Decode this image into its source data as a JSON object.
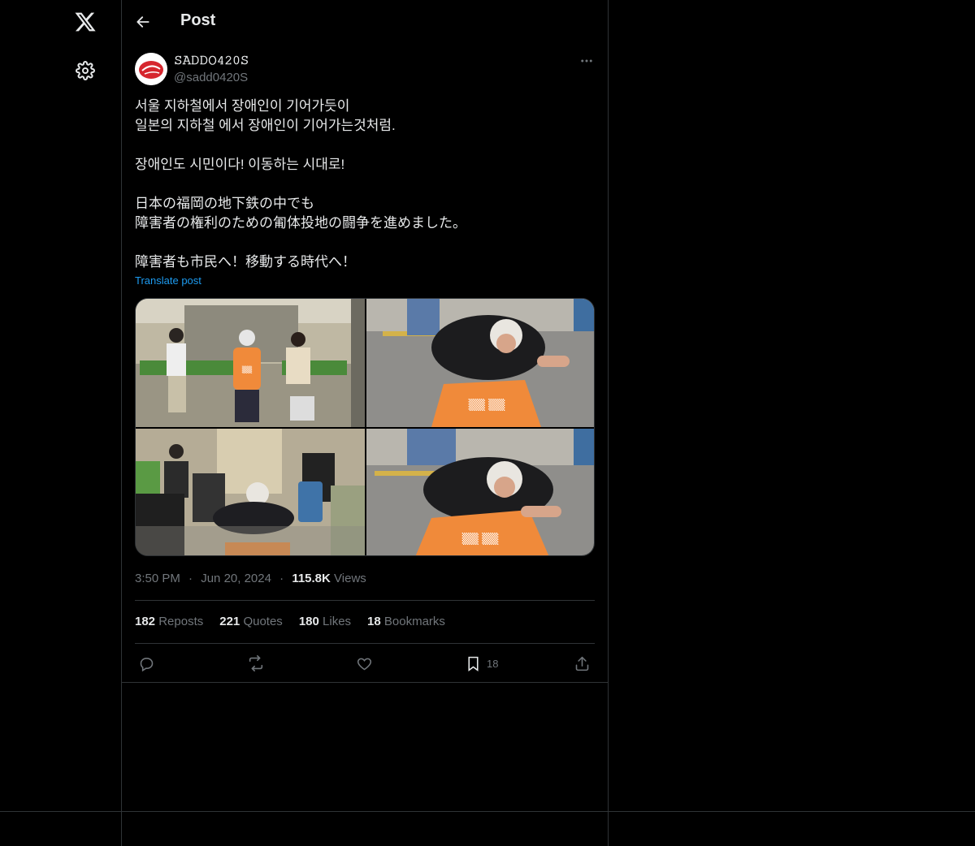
{
  "nav": {
    "logo": "X"
  },
  "header": {
    "title": "Post"
  },
  "post": {
    "author_name": "𝚂𝙰𝙳𝙳𝙾𝟺𝟸𝟶𝚂",
    "handle": "@sadd0420S",
    "body": "서울 지하철에서 장애인이 기어가듯이\n일본의 지하철 에서 장애인이 기어가는것처럼.\n\n장애인도 시민이다! 이동하는 시대로!\n\n日本の福岡の地下鉄の中でも\n障害者の権利のための匍体投地の闘争を進めました。\n\n障害者も市民へ！移動する時代へ！",
    "translate_label": "Translate post",
    "vest_text": "장애인도 시민으로 이동하는",
    "time": "3:50 PM",
    "date": "Jun 20, 2024",
    "views_count": "115.8K",
    "views_label": "Views",
    "sep": "·"
  },
  "stats": [
    {
      "count": "182",
      "label": "Reposts"
    },
    {
      "count": "221",
      "label": "Quotes"
    },
    {
      "count": "180",
      "label": "Likes"
    },
    {
      "count": "18",
      "label": "Bookmarks"
    }
  ],
  "actions": {
    "bookmark_count": "18"
  },
  "colors": {
    "background": "#000000",
    "border": "#2f3336",
    "muted": "#71767b",
    "link": "#1d9bf0",
    "text": "#e7e9ea"
  }
}
